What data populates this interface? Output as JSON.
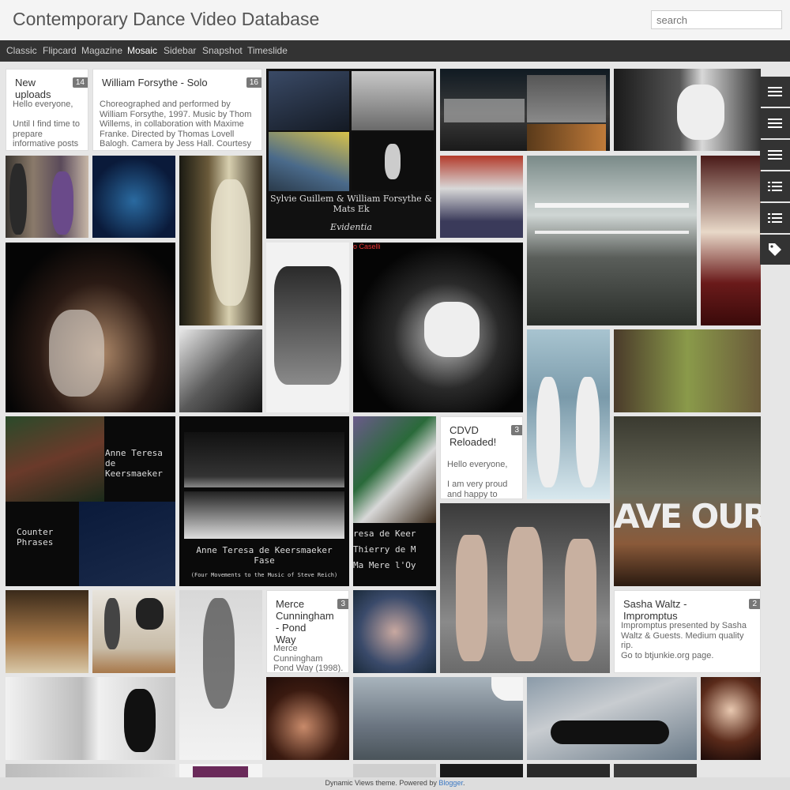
{
  "header": {
    "title": "Contemporary Dance Video Database",
    "search_placeholder": "search"
  },
  "nav": {
    "items": [
      "Classic",
      "Flipcard",
      "Magazine",
      "Mosaic",
      "Sidebar",
      "Snapshot",
      "Timeslide"
    ],
    "active": "Mosaic"
  },
  "posts": {
    "new_uploads": {
      "title": "New uploads",
      "badge": "14",
      "lines": [
        "Hello everyone,",
        "Until I find time to prepare informative posts for the videos,"
      ]
    },
    "forsythe_solo": {
      "title": "William Forsythe - Solo",
      "badge": "16",
      "text": "Choreographed and performed by William Forsythe, 1997. Music by Thom Willems, in collaboration with Maxime Franke. Directed by Thomas Lovell Balogh. Camera by Jess Hall. Courtesy of The Forsythe Company."
    },
    "cdvd": {
      "title": "CDVD Reloaded!",
      "badge": "3",
      "lines": [
        "Hello everyone,",
        "I am very proud and happy to announce"
      ]
    },
    "merce": {
      "title": "Merce Cunningham - Pond Way",
      "badge": "3",
      "text": "Merce Cunningham Pond Way (1998). Arte TvRip Divx;"
    },
    "sasha": {
      "title": "Sasha Waltz - Impromptus",
      "badge": "2",
      "lines": [
        "Impromptus presented by Sasha Waltz & Guests. Medium quality rip.",
        "Go to btjunkie.org page."
      ]
    }
  },
  "image_text": {
    "evidentia_names": "Sylvie Guillem & William Forsythe & Mats Ek",
    "evidentia_title": "Evidentia",
    "caselli": "o Caselli",
    "atdk_name": "Anne Teresa de Keersmaeker",
    "counter_phrases": "Counter Phrases",
    "fase_title": "Anne Teresa de Keersmaeker Fase",
    "fase_sub": "(Four Movements to the Music of Steve Reich)",
    "keer_lines": [
      "resa de Keer",
      "Thierry de M",
      "Ma Mere l'Oy"
    ],
    "graffiti": "AVE OUR SOUL"
  },
  "sidebar_icons": [
    "quote-list-icon",
    "quote-list-icon",
    "quote-list-icon",
    "list-icon",
    "list-icon",
    "tag-icon"
  ],
  "footer": {
    "text": "Dynamic Views theme. Powered by ",
    "link": "Blogger",
    "end": "."
  },
  "colors": {
    "nav_bg": "#333333",
    "header_bg": "#f4f4f4",
    "page_bg": "#e6e6e6",
    "link": "#3a78c4"
  }
}
